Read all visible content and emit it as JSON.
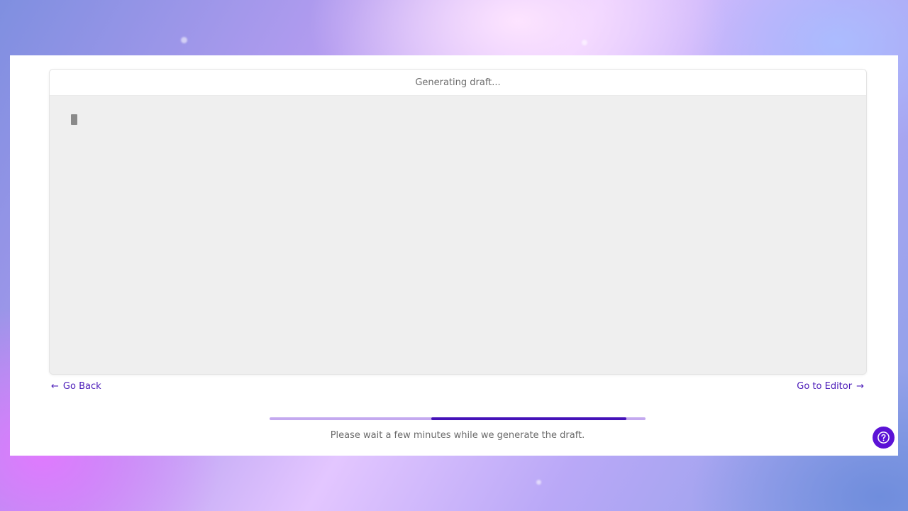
{
  "editor": {
    "header_text": "Generating draft..."
  },
  "navigation": {
    "back_label": "Go Back",
    "editor_label": "Go to Editor"
  },
  "progress": {
    "segment_start_fraction": 0.43,
    "segment_end_fraction": 0.95,
    "track_color": "#c4a9ef",
    "fill_color": "#4512b8"
  },
  "status": {
    "message": "Please wait a few minutes while we generate the draft."
  },
  "help": {
    "icon": "help-icon",
    "color": "#5b12d6"
  },
  "colors": {
    "accent": "#4a1ab8"
  }
}
